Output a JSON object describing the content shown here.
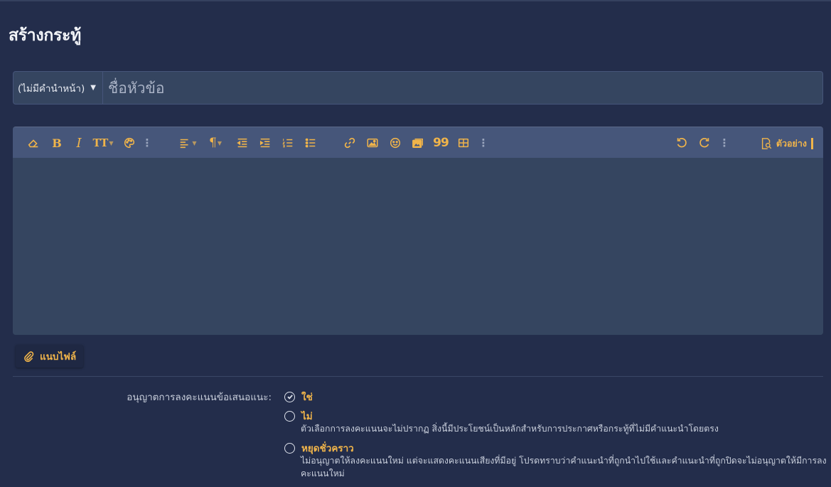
{
  "page": {
    "title": "สร้างกระทู้"
  },
  "thread": {
    "prefix_label": "(ไม่มีคำนำหน้า)",
    "title_placeholder": "ชื่อหัวข้อ"
  },
  "editor": {
    "toolbar_left": [
      "eraser-icon",
      "bold",
      "italic",
      "font-size",
      "palette-icon",
      "more",
      "align",
      "paragraph",
      "outdent",
      "indent",
      "ordered-list",
      "unordered-list",
      "link",
      "image",
      "emoji",
      "media",
      "quote",
      "table",
      "more"
    ],
    "bold_glyph": "B",
    "italic_glyph": "I",
    "fontsize_glyph": "TT",
    "paragraph_glyph": "¶",
    "quote_glyph": "99",
    "preview_label": "ตัวอย่าง"
  },
  "attach": {
    "label": "แนบไฟล์"
  },
  "poll": {
    "label": "อนุญาตการลงคะแนนข้อเสนอแนะ:",
    "options": [
      {
        "label": "ใช่",
        "selected": true,
        "hint": ""
      },
      {
        "label": "ไม่",
        "selected": false,
        "hint": "ตัวเลือกการลงคะแนนจะไม่ปรากฏ สิ่งนี้มีประโยชน์เป็นหลักสำหรับการประกาศหรือกระทู้ที่ไม่มีคำแนะนำโดยตรง"
      },
      {
        "label": "หยุดชั่วคราว",
        "selected": false,
        "hint": "ไม่อนุญาตให้ลงคะแนนใหม่ แต่จะแสดงคะแนนเสียงที่มีอยู่ โปรดทราบว่าคำแนะนำที่ถูกนำไปใช้และคำแนะนำที่ถูกปิดจะไม่อนุญาตให้มีการลง",
        "hint_2": "คะแนนใหม่"
      }
    ]
  },
  "colors": {
    "background": "#232d4b",
    "accent": "#f0b44a",
    "input": "#354560",
    "toolbar": "#46567a"
  }
}
